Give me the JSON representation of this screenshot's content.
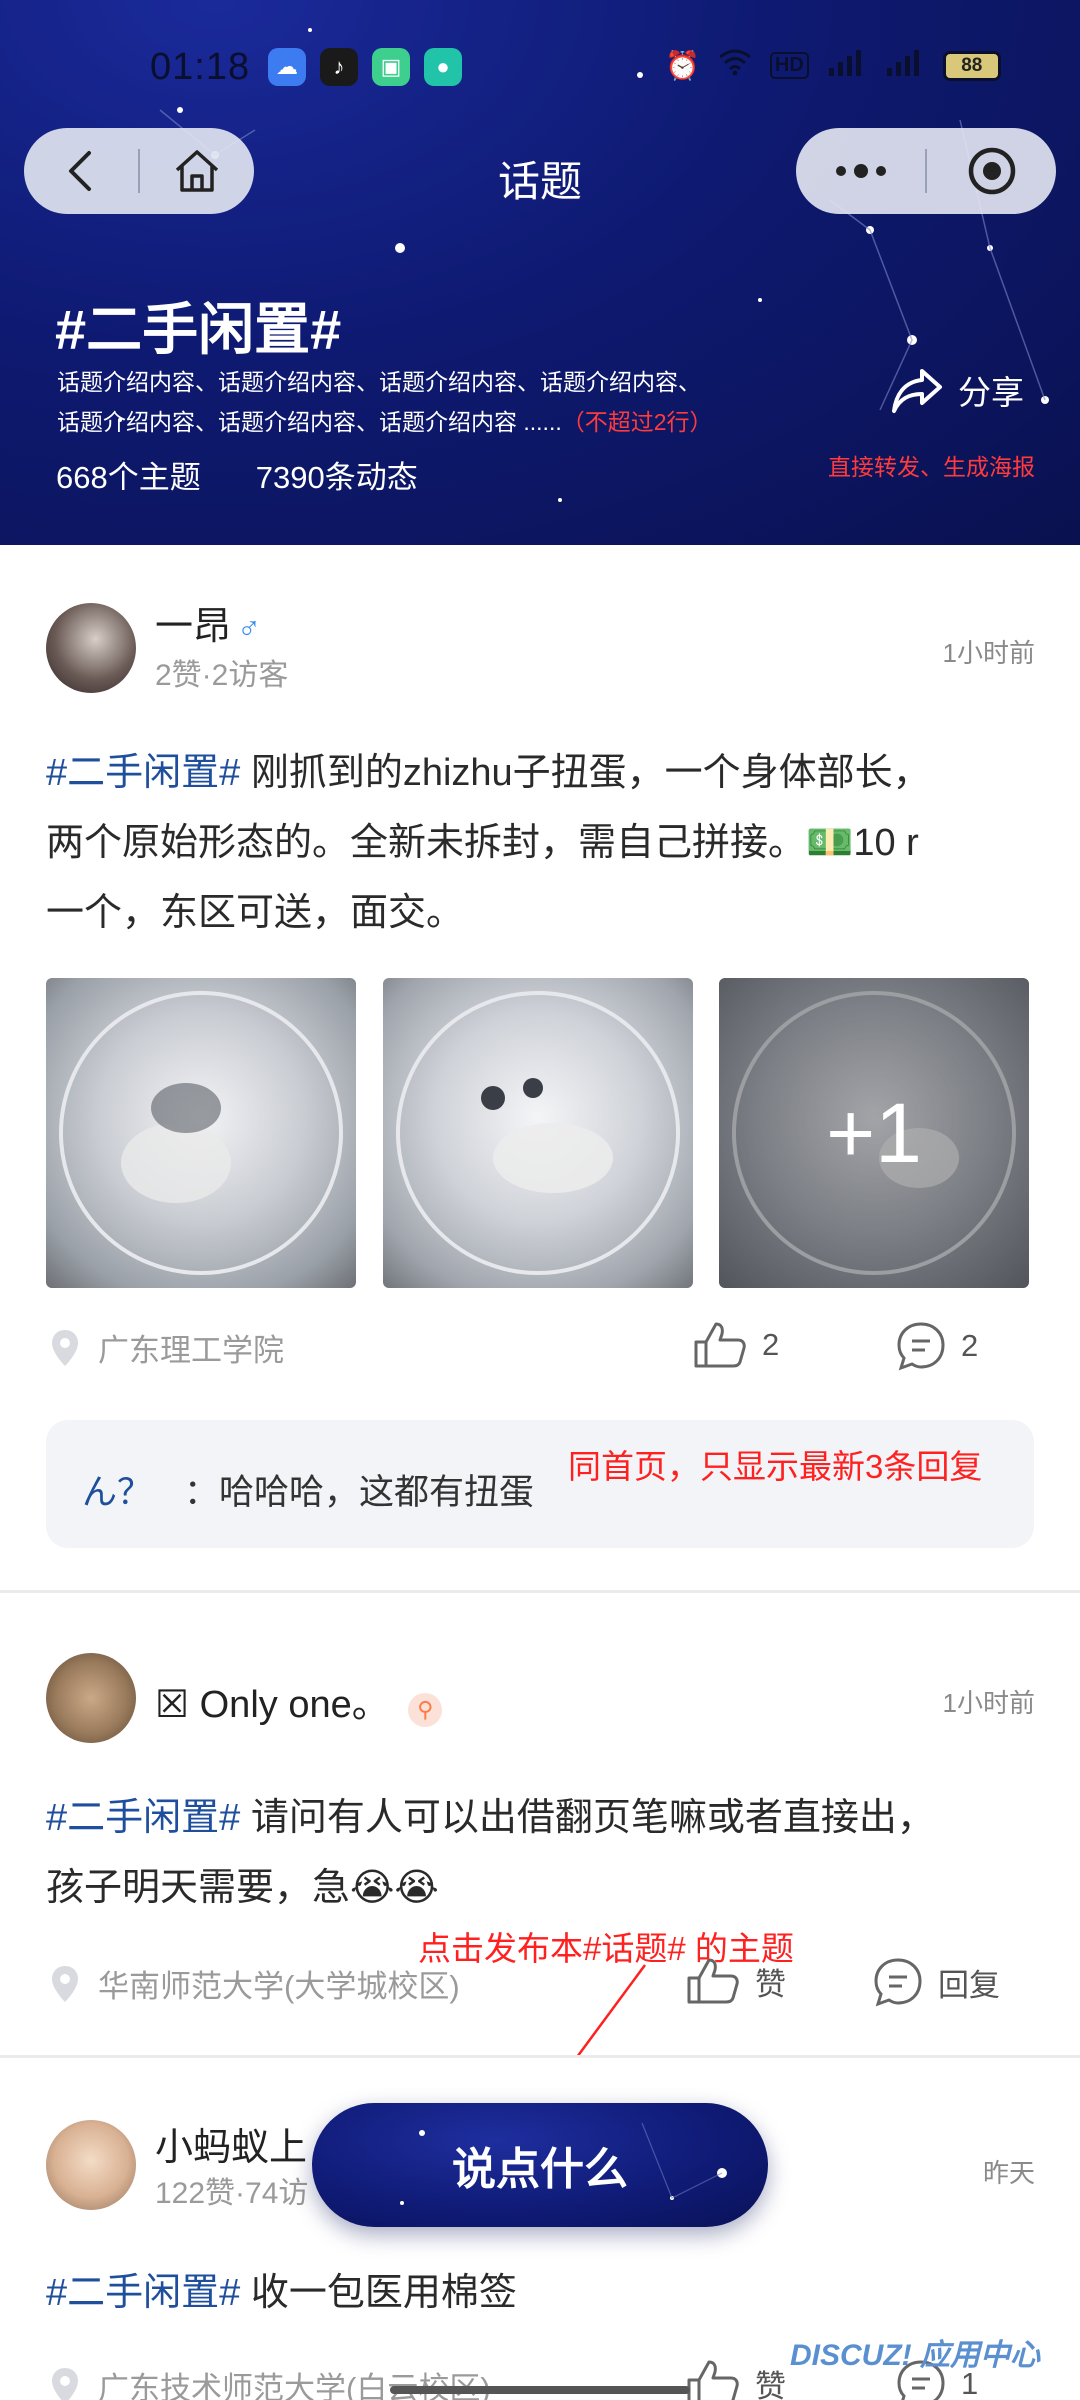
{
  "status_bar": {
    "time": "01:18",
    "battery": "88",
    "network_label": "HD"
  },
  "nav": {
    "title": "话题"
  },
  "topic": {
    "title": "#二手闲置#",
    "description_line1": "话题介绍内容、话题介绍内容、话题介绍内容、话题介绍内容、",
    "description_line2": "话题介绍内容、话题介绍内容、话题介绍内容 ......",
    "description_limit_note": "（不超过2行）",
    "topic_count": "668个主题",
    "activity_count": "7390条动态",
    "share_label": "分享",
    "share_note": "直接转发、生成海报"
  },
  "posts": [
    {
      "author": "一昂",
      "gender": "♂",
      "meta": "2赞·2访客",
      "time": "1小时前",
      "hashtag": "#二手闲置#",
      "text_line1": " 刚抓到的zhizhu子扭蛋，一个身体部长，",
      "text_line2": "两个原始形态的。全新未拆封，需自己拼接。",
      "money_emoji": "💵",
      "text_line2_tail": "10 r",
      "text_line3": "一个，东区可送，面交。",
      "more_images": "+1",
      "location": "广东理工学院",
      "likes": "2",
      "comments": "2",
      "reply_user": "ん？",
      "reply_text": "：哈哈哈，这都有扭蛋",
      "reply_note": "同首页，只显示最新3条回复"
    },
    {
      "author": "☒ Only one。",
      "time": "1小时前",
      "hashtag": "#二手闲置#",
      "text_line1": " 请问有人可以出借翻页笔嘛或者直接出，",
      "text_line2": "孩子明天需要，急😭😭",
      "location": "华南师范大学(大学城校区)",
      "like_label": "赞",
      "reply_label": "回复",
      "publish_note": "点击发布本#话题# 的主题"
    },
    {
      "author": "小蚂蚁上",
      "meta": "122赞·74访",
      "time": "昨天",
      "hashtag": "#二手闲置#",
      "text_line1": " 收一包医用棉签",
      "location": "广东技术师范大学(白云校区)",
      "like_label": "赞",
      "comments": "1"
    }
  ],
  "fab": {
    "label": "说点什么"
  },
  "watermark": "DISCUZ! 应用中心",
  "colors": {
    "header_bg": "#0e1a72",
    "hashtag": "#1f4f9c",
    "annotation": "#ff2020"
  }
}
